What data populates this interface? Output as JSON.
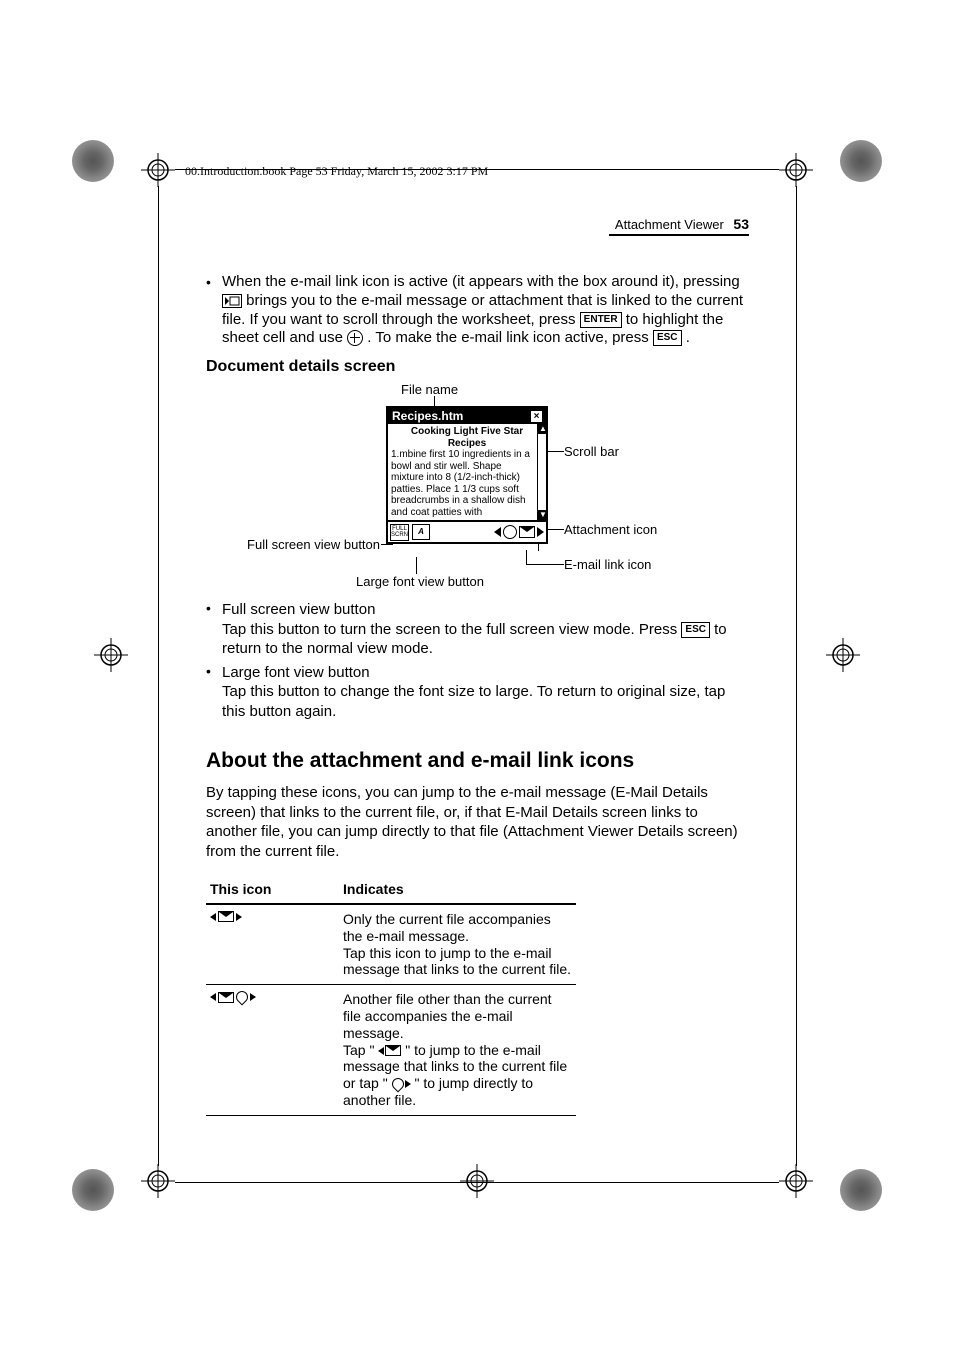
{
  "running_head": "00.Introduction.book  Page 53  Friday, March 15, 2002  3:17 PM",
  "header": {
    "section": "Attachment Viewer",
    "page": "53"
  },
  "bullet_top": {
    "line1a": "When the e-mail link icon is active (it appears with the box around it), pressing ",
    "line1b": " brings you to the e-mail message or attachment that is linked to the current file. If you want to scroll through the worksheet, press ",
    "key_enter": "ENTER",
    "line1c": " to highlight the sheet cell and use ",
    "line1d": ". To make the e-mail link icon active, press ",
    "key_esc": "ESC",
    "line1e": "."
  },
  "subhead1": "Document details screen",
  "diagram": {
    "label_filename": "File name",
    "label_scrollbar": "Scroll bar",
    "label_attachicon": "Attachment icon",
    "label_emaillink": "E-mail link icon",
    "label_fullscreen": "Full screen view button",
    "label_largefont": "Large font view button",
    "screen_title": "Recipes.htm",
    "screen_heading": "Cooking Light Five Star Recipes",
    "screen_body": "1.mbine first 10 ingredients in a bowl and stir well. Shape mixture into 8 (1/2-inch-thick) patties. Place 1 1/3 cups soft breadcrumbs in a shallow dish and coat patties with"
  },
  "bullets_mid": [
    {
      "title": "Full screen view button",
      "desc_a": "Tap this button to turn the screen to the full screen view mode. Press ",
      "key_esc": "ESC",
      "desc_b": " to return to the normal view mode."
    },
    {
      "title": "Large font view button",
      "desc_a": "Tap this button to change the font size to large. To return to original size, tap this button again.",
      "key_esc": "",
      "desc_b": ""
    }
  ],
  "section2": "About the attachment and e-mail link icons",
  "para2": "By tapping these icons, you can jump to the e-mail message (E-Mail Details screen) that links to the current file, or, if that E-Mail Details screen links to another file, you can jump directly to that file (Attachment Viewer Details screen) from the current file.",
  "table": {
    "h1": "This icon",
    "h2": "Indicates",
    "rows": [
      {
        "kind": "single",
        "text_a": "Only the current file accompanies the e-mail message.",
        "text_b": "Tap this icon to jump to the e-mail message that links to the current file."
      },
      {
        "kind": "multi",
        "text_a": "Another file other than the current file accompanies the e-mail message.",
        "text_b_pre": "Tap \"",
        "text_b_mid": "\" to jump to the e-mail message that links to the current file or tap \"",
        "text_b_post": "\" to jump directly to another file."
      }
    ]
  }
}
